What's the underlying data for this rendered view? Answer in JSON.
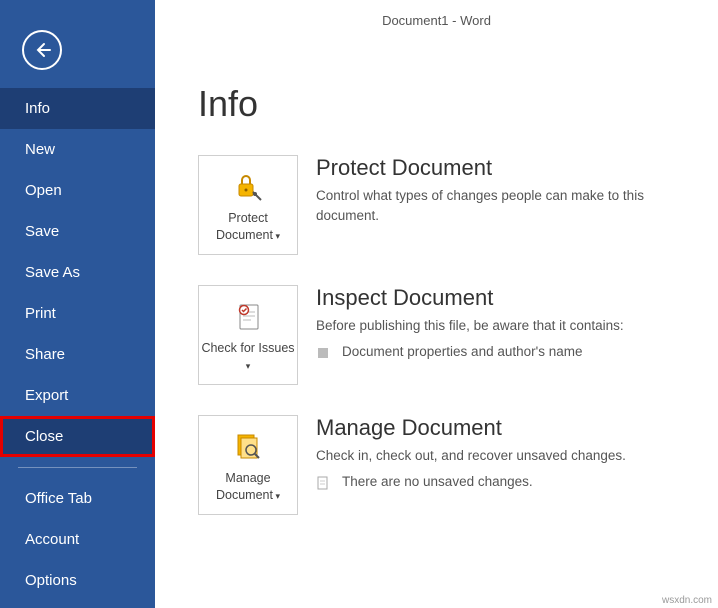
{
  "window_title": "Document1 - Word",
  "page_header": "Info",
  "nav": {
    "back": "back",
    "items": [
      "Info",
      "New",
      "Open",
      "Save",
      "Save As",
      "Print",
      "Share",
      "Export",
      "Close"
    ],
    "items2": [
      "Office Tab",
      "Account",
      "Options"
    ]
  },
  "sections": {
    "protect": {
      "tile_label": "Protect Document",
      "title": "Protect Document",
      "desc": "Control what types of changes people can make to this document."
    },
    "inspect": {
      "tile_label": "Check for Issues",
      "title": "Inspect Document",
      "desc": "Before publishing this file, be aware that it contains:",
      "bullet": "Document properties and author's name"
    },
    "manage": {
      "tile_label": "Manage Document",
      "title": "Manage Document",
      "desc": "Check in, check out, and recover unsaved changes.",
      "bullet": "There are no unsaved changes."
    }
  },
  "watermark": "wsxdn.com"
}
